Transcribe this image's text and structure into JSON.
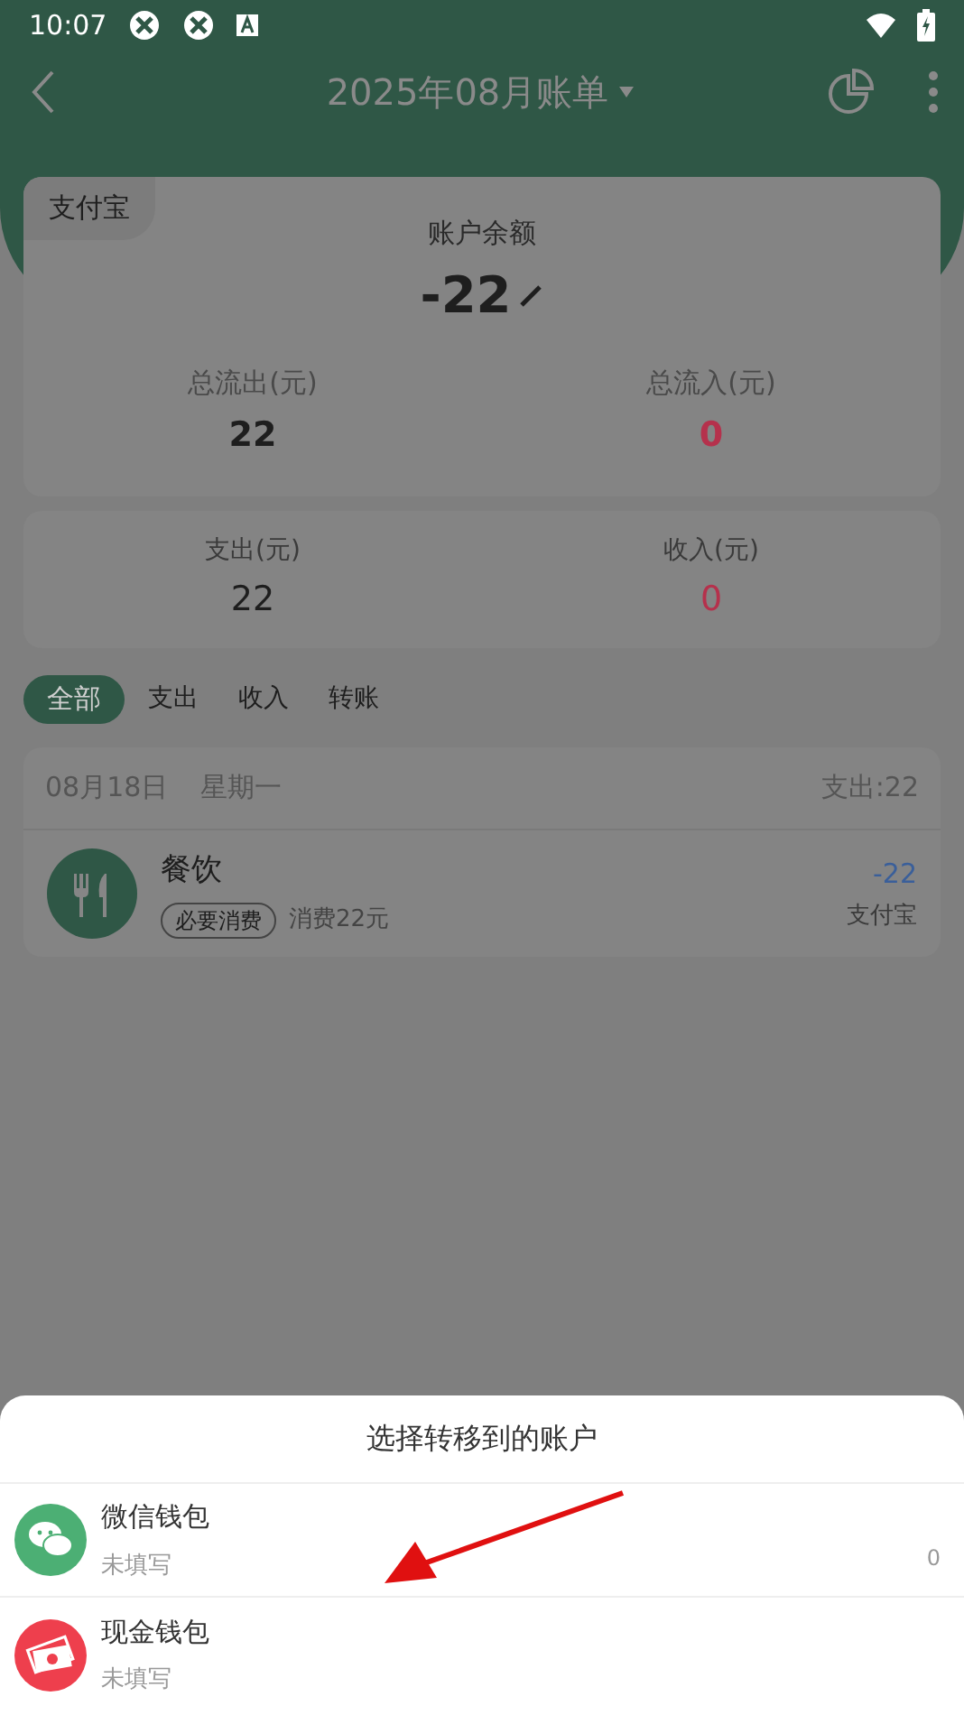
{
  "status_bar": {
    "time": "10:07"
  },
  "toolbar": {
    "title": "2025年08月账单"
  },
  "balance_card": {
    "account_tag": "支付宝",
    "label": "账户余额",
    "amount": "-22",
    "stats": [
      {
        "label": "总流出(元)",
        "value": "22",
        "kind": "out"
      },
      {
        "label": "总流入(元)",
        "value": "0",
        "kind": "in"
      }
    ]
  },
  "summary_card": {
    "stats": [
      {
        "label": "支出(元)",
        "value": "22",
        "kind": "out"
      },
      {
        "label": "收入(元)",
        "value": "0",
        "kind": "in"
      }
    ]
  },
  "tabs": [
    {
      "label": "全部",
      "selected": true
    },
    {
      "label": "支出",
      "selected": false
    },
    {
      "label": "收入",
      "selected": false
    },
    {
      "label": "转账",
      "selected": false
    }
  ],
  "day_group": {
    "date": "08月18日",
    "weekday": "星期一",
    "total": "支出:22",
    "records": [
      {
        "category": "餐饮",
        "tag": "必要消费",
        "note": "消费22元",
        "amount": "-22",
        "account": "支付宝"
      }
    ]
  },
  "bottom_sheet": {
    "title": "选择转移到的账户",
    "accounts": [
      {
        "name": "微信钱包",
        "note": "未填写",
        "balance": "0",
        "kind": "wechat"
      },
      {
        "name": "现金钱包",
        "note": "未填写",
        "kind": "cash"
      }
    ]
  }
}
